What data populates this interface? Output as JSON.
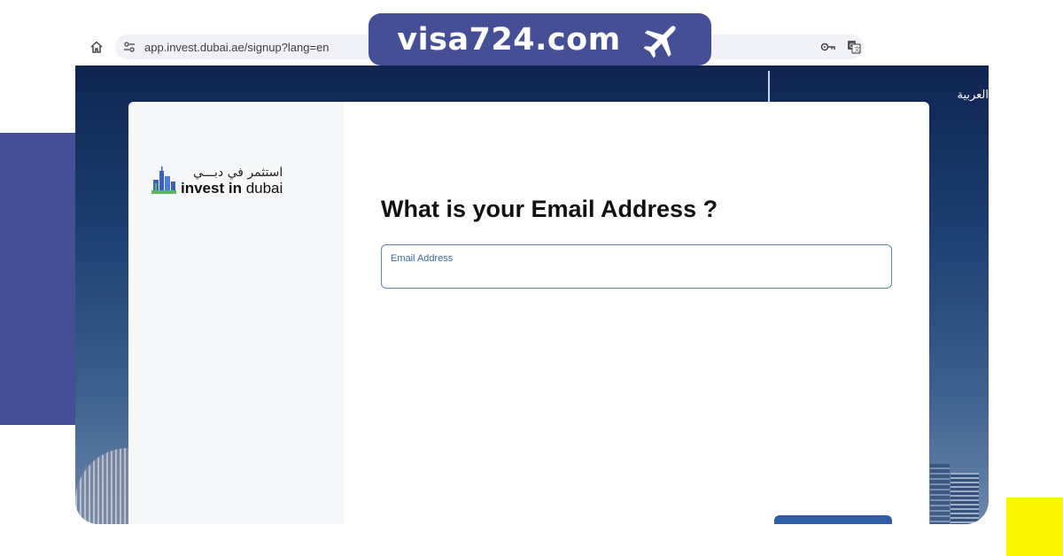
{
  "browser": {
    "url": "app.invest.dubai.ae/signup?lang=en",
    "home_icon": "home-icon",
    "site_settings_icon": "tune-icon",
    "password_icon": "key-icon",
    "translate_icon": "translate-icon"
  },
  "watermark": {
    "brand": "visa724.com",
    "icon": "airplane-icon",
    "color": "#454f96"
  },
  "header": {
    "language_link": "العربية"
  },
  "logo": {
    "arabic": "استثمر في دبـــي",
    "english_bold": "invest in",
    "english_regular": " dubai"
  },
  "form": {
    "question_prefix": "What is your ",
    "question_bold": "Email Address",
    "question_suffix": " ?",
    "email_label": "Email Address",
    "email_value": "",
    "next_button_label": ""
  },
  "colors": {
    "accent": "#2f5ea6",
    "input_border": "#5f83b0",
    "decor_blue": "#454f96",
    "decor_yellow": "#f9f400"
  }
}
